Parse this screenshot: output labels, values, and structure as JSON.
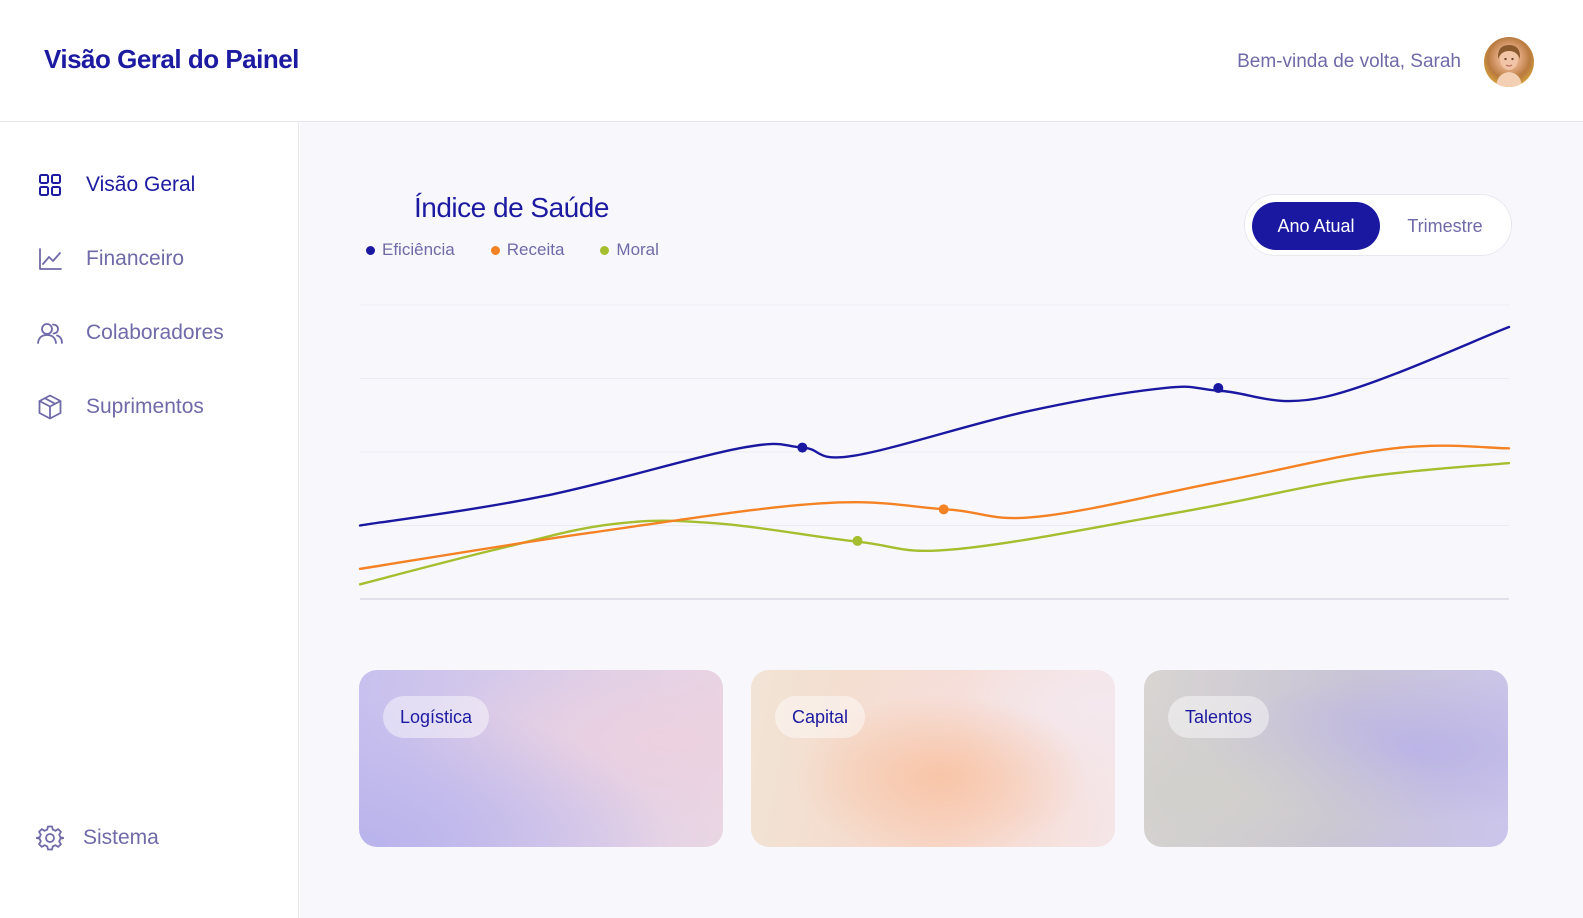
{
  "header": {
    "title": "Visão Geral do Painel",
    "welcome": "Bem-vinda de volta, Sarah"
  },
  "sidebar": {
    "items": [
      {
        "label": "Visão Geral",
        "icon": "grid-icon",
        "active": true
      },
      {
        "label": "Financeiro",
        "icon": "line-chart-icon",
        "active": false
      },
      {
        "label": "Colaboradores",
        "icon": "users-icon",
        "active": false
      },
      {
        "label": "Suprimentos",
        "icon": "box-icon",
        "active": false
      }
    ],
    "footer": {
      "label": "Sistema",
      "icon": "gear-icon"
    }
  },
  "panel": {
    "title": "Índice de Saúde",
    "toggle": {
      "options": [
        "Ano Atual",
        "Trimestre"
      ],
      "selected": "Ano Atual"
    }
  },
  "chart_data": {
    "type": "line",
    "title": "Índice de Saúde",
    "grid": true,
    "legend_position": "top-left",
    "ylim": [
      0,
      4
    ],
    "series": [
      {
        "name": "Eficiência",
        "color": "#1a18a0",
        "points": [
          [
            0.0,
            1.0
          ],
          [
            0.16,
            1.4
          ],
          [
            0.33,
            2.05
          ],
          [
            0.385,
            2.06
          ],
          [
            0.43,
            1.95
          ],
          [
            0.58,
            2.55
          ],
          [
            0.7,
            2.87
          ],
          [
            0.75,
            2.83
          ],
          [
            0.84,
            2.75
          ],
          [
            1.0,
            3.7
          ]
        ],
        "markers": [
          [
            0.385,
            2.06
          ],
          [
            0.747,
            2.87
          ]
        ]
      },
      {
        "name": "Receita",
        "color": "#f48224",
        "points": [
          [
            0.0,
            0.41
          ],
          [
            0.2,
            0.9
          ],
          [
            0.4,
            1.3
          ],
          [
            0.51,
            1.22
          ],
          [
            0.59,
            1.12
          ],
          [
            0.75,
            1.6
          ],
          [
            0.9,
            2.05
          ],
          [
            1.0,
            2.05
          ]
        ],
        "markers": [
          [
            0.508,
            1.22
          ]
        ]
      },
      {
        "name": "Moral",
        "color": "#a5be2f",
        "points": [
          [
            0.0,
            0.2
          ],
          [
            0.12,
            0.68
          ],
          [
            0.22,
            1.02
          ],
          [
            0.31,
            1.03
          ],
          [
            0.433,
            0.78
          ],
          [
            0.52,
            0.68
          ],
          [
            0.72,
            1.2
          ],
          [
            0.87,
            1.65
          ],
          [
            1.0,
            1.85
          ]
        ],
        "markers": [
          [
            0.433,
            0.79
          ]
        ]
      }
    ]
  },
  "cards": [
    {
      "label": "Logística"
    },
    {
      "label": "Capital"
    },
    {
      "label": "Talentos"
    }
  ]
}
